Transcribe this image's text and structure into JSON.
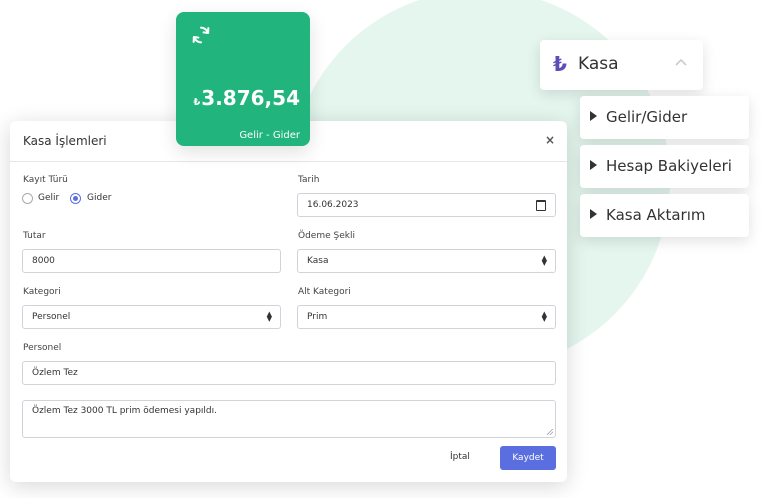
{
  "summary_card": {
    "currency_symbol": "₺",
    "amount": "3.876,54",
    "subtitle": "Gelir - Gider",
    "icon": "sync-icon"
  },
  "kasa_menu": {
    "icon_symbol": "₺",
    "label": "Kasa",
    "icon": "chevron-up-icon",
    "items": [
      {
        "label": "Gelir/Gider"
      },
      {
        "label": "Hesap Bakiyeleri"
      },
      {
        "label": "Kasa Aktarım"
      }
    ]
  },
  "modal": {
    "title": "Kasa İşlemleri",
    "close": "×",
    "kayit_turu": {
      "label": "Kayıt Türü",
      "options": [
        {
          "label": "Gelir",
          "selected": false
        },
        {
          "label": "Gider",
          "selected": true
        }
      ]
    },
    "tarih": {
      "label": "Tarih",
      "value": "16.06.2023"
    },
    "tutar": {
      "label": "Tutar",
      "value": "8000"
    },
    "odeme_sekli": {
      "label": "Ödeme Şekli",
      "value": "Kasa"
    },
    "kategori": {
      "label": "Kategori",
      "value": "Personel"
    },
    "alt_kategori": {
      "label": "Alt Kategori",
      "value": "Prim"
    },
    "personel": {
      "label": "Personel",
      "value": "Özlem Tez"
    },
    "aciklama": {
      "value": "Özlem Tez 3000 TL prim ödemesi yapıldı."
    },
    "cancel_label": "İptal",
    "save_label": "Kaydet"
  },
  "colors": {
    "card_green": "#21b47d",
    "accent_blue": "#5b6ee0",
    "lira_purple": "#5b4fb5",
    "bg_circle": "#e4f6ee"
  }
}
